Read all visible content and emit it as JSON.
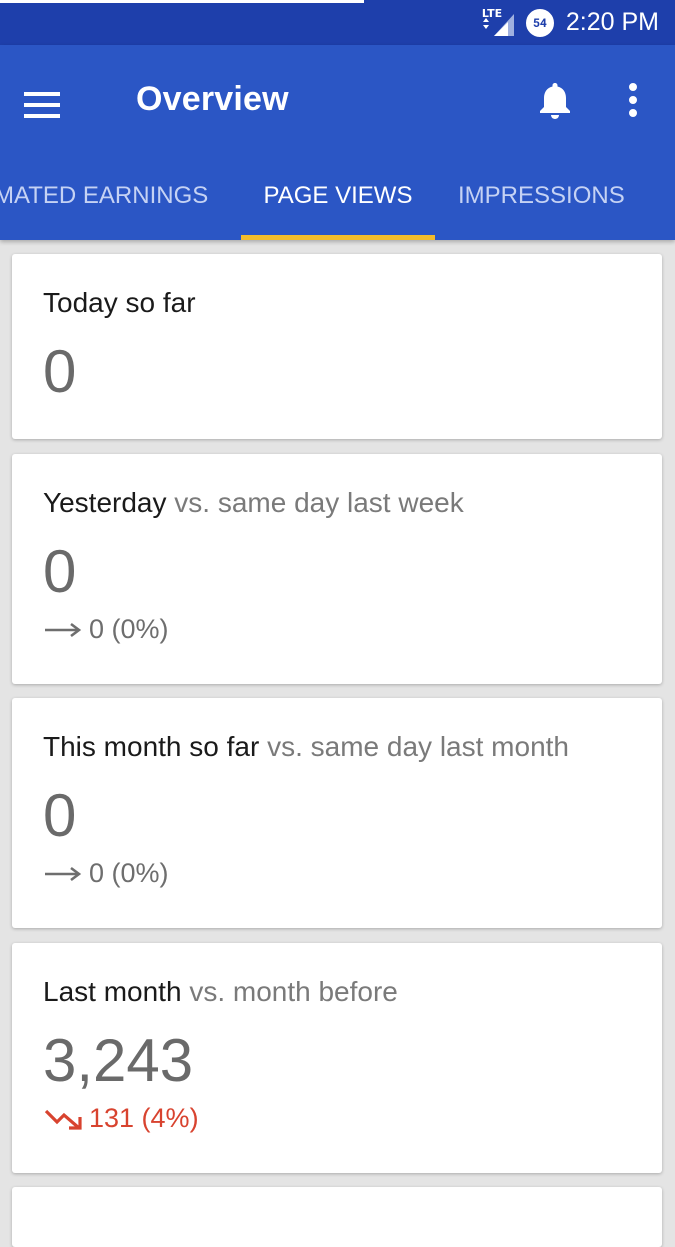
{
  "status_bar": {
    "network": "LTE",
    "battery_level": "54",
    "time": "2:20 PM"
  },
  "app_bar": {
    "title": "Overview",
    "icons": [
      "menu-icon",
      "bell-icon",
      "more-vert-icon"
    ]
  },
  "tabs": [
    {
      "label": "ESTIMATED EARNINGS",
      "visible_text": "MATED EARNINGS",
      "active": false
    },
    {
      "label": "PAGE VIEWS",
      "visible_text": "PAGE VIEWS",
      "active": true
    },
    {
      "label": "IMPRESSIONS",
      "visible_text": "IMPRESSIONS",
      "active": false
    }
  ],
  "cards": [
    {
      "label": "Today so far",
      "comparison": "",
      "value": "0"
    },
    {
      "label": "Yesterday",
      "comparison": "vs. same day last week",
      "value": "0",
      "change": "0 (0%)",
      "trend": "flat"
    },
    {
      "label": "This month so far",
      "comparison": "vs. same day last month",
      "value": "0",
      "change": "0 (0%)",
      "trend": "flat"
    },
    {
      "label": "Last month",
      "comparison": "vs. month before",
      "value": "3,243",
      "change": "131 (4%)",
      "trend": "down"
    }
  ],
  "colors": {
    "status_bar": "#1e3fab",
    "app_bar": "#2b56c5",
    "tab_indicator": "#f3bc2b",
    "negative": "#d8432f",
    "background": "#e4e4e4"
  }
}
